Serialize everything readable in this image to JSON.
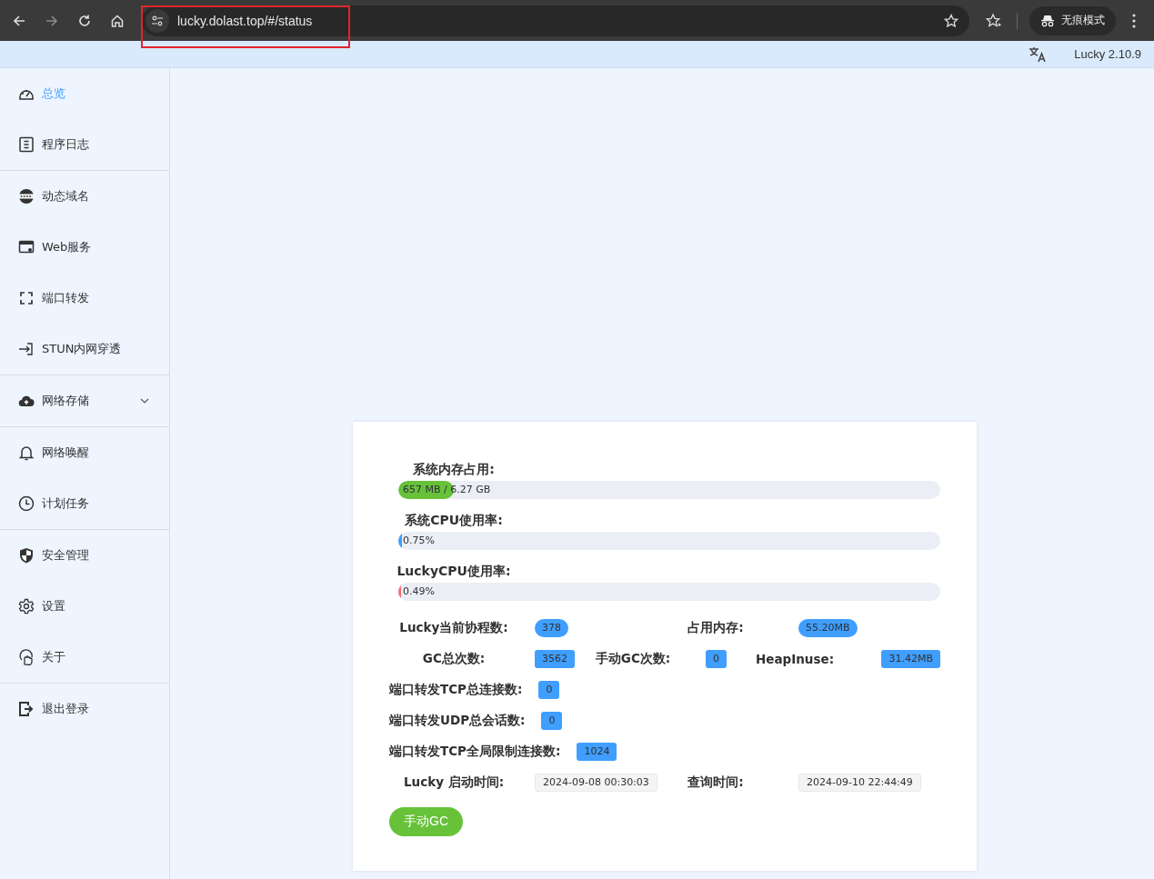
{
  "browser": {
    "nav": [
      {
        "kind": "back",
        "disabled": false
      },
      {
        "kind": "forward",
        "disabled": true
      },
      {
        "kind": "reload",
        "disabled": false
      },
      {
        "kind": "home",
        "disabled": false
      }
    ],
    "url": "lucky.dolast.top/#/status",
    "url_highlighted": true,
    "profile": "无痕模式"
  },
  "header": {
    "version": "Lucky 2.10.9"
  },
  "sidebar": {
    "groups": [
      [
        {
          "label": "总览",
          "selected": true
        },
        {
          "label": "程序日志",
          "selected": false
        }
      ],
      [
        {
          "label": "动态域名",
          "selected": false
        },
        {
          "label": "Web服务",
          "selected": false
        },
        {
          "label": "端口转发",
          "selected": false
        },
        {
          "label": "STUN内网穿透",
          "selected": false
        }
      ],
      [
        {
          "label": "网络存储",
          "selected": false,
          "expanded": false
        }
      ],
      [
        {
          "label": "网络唤醒",
          "selected": false
        },
        {
          "label": "计划任务",
          "selected": false
        }
      ],
      [
        {
          "label": "安全管理",
          "selected": false
        },
        {
          "label": "设置",
          "selected": false
        },
        {
          "label": "关于",
          "selected": false
        }
      ],
      [
        {
          "label": "退出登录",
          "selected": false
        }
      ]
    ]
  },
  "status": {
    "bars": [
      {
        "label": "系统内存占用:",
        "reading": "657 MB / 6.27 GB",
        "level": 0.102,
        "color": "#67c23a"
      },
      {
        "label": "系统CPU使用率:",
        "reading": "0.75%",
        "level": 0.0075,
        "color": "#409eff"
      },
      {
        "label": "LuckyCPU使用率:",
        "reading": "0.49%",
        "level": 0.0049,
        "color": "#f56c6c"
      }
    ],
    "stat_rows": [
      [
        {
          "label": "Lucky当前协程数:",
          "value": "378",
          "kind": "pill"
        },
        {
          "label": "占用内存:",
          "value": "55.20MB",
          "kind": "pill"
        }
      ],
      [
        {
          "label": "GC总次数:",
          "value": "3562",
          "kind": "tag"
        },
        {
          "label": "手动GC次数:",
          "value": "0",
          "kind": "tag"
        },
        {
          "label": "HeapInuse:",
          "value": "31.42MB",
          "kind": "tag"
        }
      ],
      [
        {
          "label": "端口转发TCP总连接数:",
          "value": "0",
          "kind": "tag"
        }
      ],
      [
        {
          "label": "端口转发UDP总会话数:",
          "value": "0",
          "kind": "tag"
        }
      ],
      [
        {
          "label": "端口转发TCP全局限制连接数:",
          "value": "1024",
          "kind": "tag"
        }
      ],
      [
        {
          "label": "Lucky 启动时间:",
          "value": "2024-09-08 00:30:03",
          "kind": "time"
        },
        {
          "label": "查询时间:",
          "value": "2024-09-10 22:44:49",
          "kind": "time"
        }
      ]
    ],
    "gc_button": "手动GC"
  }
}
